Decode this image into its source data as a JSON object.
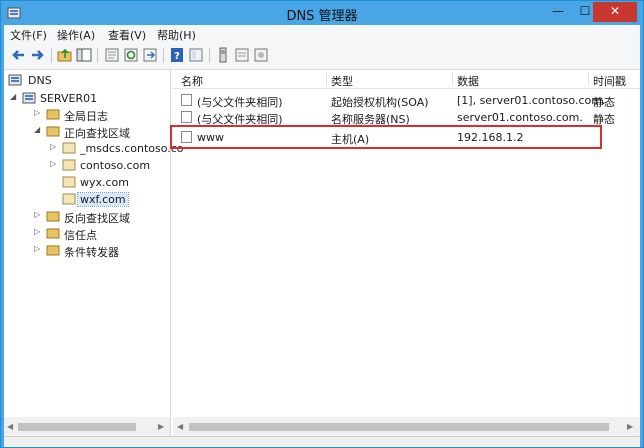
{
  "window": {
    "title": "DNS 管理器",
    "controls": {
      "minimize": "—",
      "maximize": "☐",
      "close": "✕"
    }
  },
  "menu": [
    "文件(F)",
    "操作(A)",
    "查看(V)",
    "帮助(H)"
  ],
  "toolbar": {
    "buttons": [
      "back-arrow-icon",
      "forward-arrow-icon",
      "folder-up-icon",
      "console-tree-icon",
      "properties-icon",
      "refresh-icon",
      "export-list-icon",
      "help-icon",
      "show-hide-icon",
      "server-icon",
      "new-record-icon",
      "wizard-icon"
    ]
  },
  "tree": {
    "root": "DNS",
    "server": "SERVER01",
    "global_logs": "全局日志",
    "forward_zones": "正向查找区域",
    "zone_msdcs": "_msdcs.contoso.co",
    "zone_contoso": "contoso.com",
    "zone_wyx": "wyx.com",
    "zone_wxf": "wxf.com",
    "reverse_zones": "反向查找区域",
    "trust_points": "信任点",
    "conditional_forwarders": "条件转发器"
  },
  "list": {
    "columns": [
      "名称",
      "类型",
      "数据",
      "时间戳"
    ],
    "rows": [
      {
        "name": "(与父文件夹相同)",
        "type": "起始授权机构(SOA)",
        "data": "[1], server01.contoso.com.",
        "timestamp": "静态"
      },
      {
        "name": "(与父文件夹相同)",
        "type": "名称服务器(NS)",
        "data": "server01.contoso.com.",
        "timestamp": "静态"
      },
      {
        "name": "www",
        "type": "主机(A)",
        "data": "192.168.1.2",
        "timestamp": ""
      }
    ]
  },
  "colors": {
    "title_bar": "#48a6e6",
    "close_button": "#c7372f",
    "highlight_box": "#e02b2b"
  }
}
